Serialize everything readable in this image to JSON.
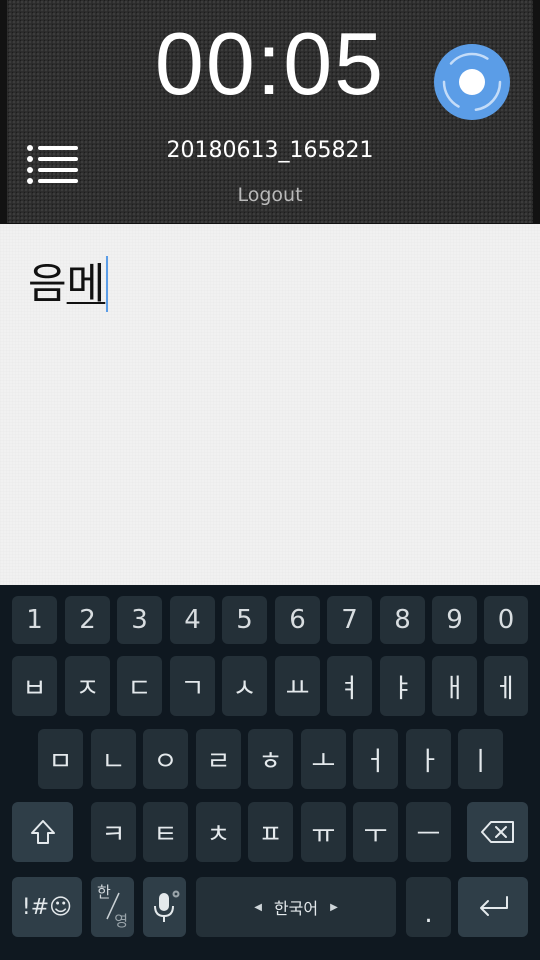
{
  "header": {
    "timer": "00:05",
    "session_name": "20180613_165821",
    "logout_label": "Logout",
    "record_button_color": "#5b9de7",
    "menu_icon": "hamburger-list-icon"
  },
  "note": {
    "committed_text": "음",
    "composing_text": "메",
    "caret_color": "#5b9de7"
  },
  "keyboard": {
    "number_row": [
      "1",
      "2",
      "3",
      "4",
      "5",
      "6",
      "7",
      "8",
      "9",
      "0"
    ],
    "row1": [
      "ㅂ",
      "ㅈ",
      "ㄷ",
      "ㄱ",
      "ㅅ",
      "ㅛ",
      "ㅕ",
      "ㅑ",
      "ㅐ",
      "ㅔ"
    ],
    "row2": [
      "ㅁ",
      "ㄴ",
      "ㅇ",
      "ㄹ",
      "ㅎ",
      "ㅗ",
      "ㅓ",
      "ㅏ",
      "ㅣ"
    ],
    "row3": [
      "ㅋ",
      "ㅌ",
      "ㅊ",
      "ㅍ",
      "ㅠ",
      "ㅜ",
      "ㅡ"
    ],
    "shift_icon": "shift-arrow-icon",
    "backspace_icon": "backspace-icon",
    "symbols_label": "!#☺",
    "lang_toggle_top": "한",
    "lang_toggle_bottom": "영",
    "mic_icon": "microphone-icon",
    "space_label": "한국어",
    "space_left_arrow": "◀",
    "space_right_arrow": "▶",
    "period_label": ".",
    "enter_icon": "enter-icon",
    "key_color": "#243038",
    "background_color": "#0f1820"
  }
}
